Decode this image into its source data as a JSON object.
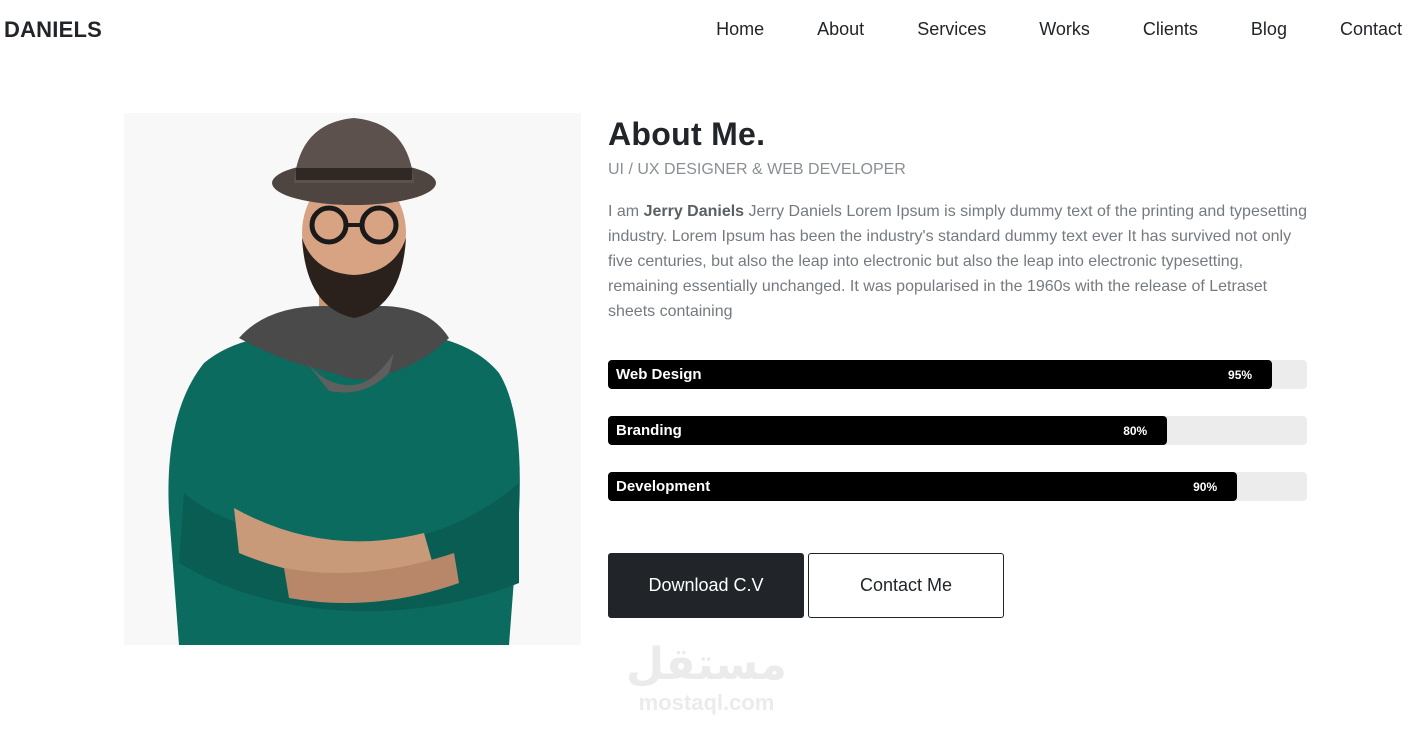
{
  "nav": {
    "brand": "DANIELS",
    "items": [
      "Home",
      "About",
      "Services",
      "Works",
      "Clients",
      "Blog",
      "Contact"
    ]
  },
  "about": {
    "title": "About Me.",
    "subtitle": "UI / UX DESIGNER & WEB DEVELOPER",
    "bio_prefix": "I am ",
    "bio_name": "Jerry Daniels",
    "bio_text": " Jerry Daniels Lorem Ipsum is simply dummy text of the printing and typesetting industry. Lorem Ipsum has been the industry's standard dummy text ever It has survived not only five centuries, but also the leap into electronic but also the leap into electronic typesetting, remaining essentially unchanged. It was popularised in the 1960s with the release of Letraset sheets containing"
  },
  "skills": [
    {
      "name": "Web Design",
      "percent_label": "95%",
      "value": 0.95
    },
    {
      "name": "Branding",
      "percent_label": "80%",
      "value": 0.8
    },
    {
      "name": "Development",
      "percent_label": "90%",
      "value": 0.9
    }
  ],
  "buttons": {
    "download": "Download C.V",
    "contact": "Contact Me"
  },
  "watermark": {
    "arabic": "مستقل",
    "latin": "mostaql.com"
  },
  "colors": {
    "primary_dark": "#212529",
    "skill_fill": "#000000",
    "skill_track": "#ececec",
    "sweater": "#0b6b5e"
  }
}
